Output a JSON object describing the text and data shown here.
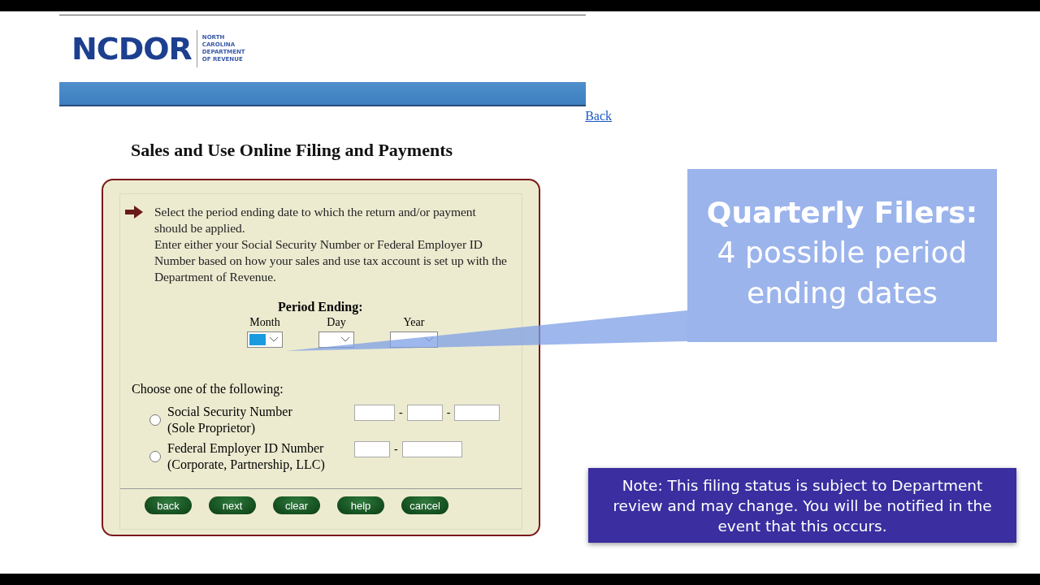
{
  "header": {
    "logo": "NCDOR",
    "logo_subtitle": [
      "NORTH",
      "CAROLINA",
      "DEPARTMENT",
      "OF REVENUE"
    ]
  },
  "back_link": "Back",
  "title": "Sales and Use Online Filing and Payments",
  "instructions": [
    "Select the period ending date to which the return and/or payment should be applied.",
    "Enter either your Social Security Number or Federal Employer ID Number based on how your sales and use tax account is set up with the Department of Revenue."
  ],
  "period_ending": {
    "label": "Period Ending:",
    "selects": [
      {
        "label": "Month",
        "highlighted": true
      },
      {
        "label": "Day",
        "highlighted": false
      },
      {
        "label": "Year",
        "highlighted": false
      }
    ]
  },
  "choose_label": "Choose one of the following:",
  "options": [
    {
      "label": "Social Security Number",
      "sublabel": "(Sole Proprietor)",
      "selected": false,
      "separators": [
        "-",
        "-"
      ]
    },
    {
      "label": "Federal Employer ID Number",
      "sublabel": "(Corporate, Partnership, LLC)",
      "selected": false,
      "separators": [
        "-"
      ]
    }
  ],
  "buttons": [
    "back",
    "next",
    "clear",
    "help",
    "cancel"
  ],
  "callout": {
    "title": "Quarterly Filers:",
    "text": "4 possible period ending dates"
  },
  "note": "Note: This filing status is subject to Department review and may change. You will be notified in the event that this occurs."
}
